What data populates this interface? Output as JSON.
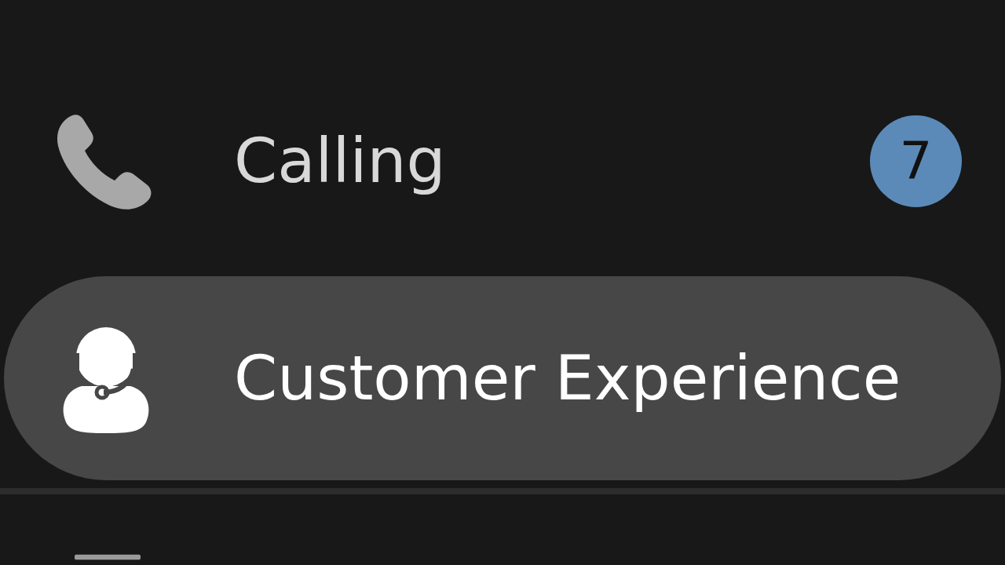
{
  "sidebar": {
    "items": [
      {
        "kind": "calling",
        "label": "Calling",
        "badge": "7",
        "selected": false
      },
      {
        "kind": "customer",
        "label": "Customer Experience",
        "selected": true
      },
      {
        "kind": "partial"
      }
    ]
  }
}
